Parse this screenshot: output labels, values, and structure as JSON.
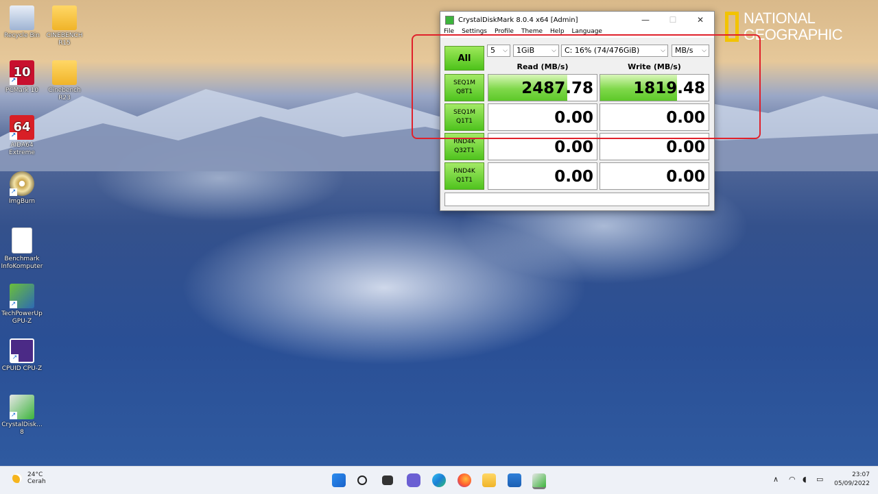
{
  "desktop": {
    "icons": [
      {
        "label": "Recycle Bin",
        "icon": "recycle-bin-icon"
      },
      {
        "label": "CINEBENCH R15",
        "icon": "folder-icon"
      },
      {
        "label": "PCMark 10",
        "icon": "pcmark-icon",
        "badge": "10"
      },
      {
        "label": "Cinebench R23",
        "icon": "folder-icon"
      },
      {
        "label": "AIDA64 Extreme",
        "icon": "aida64-icon",
        "badge": "64"
      },
      {
        "label": "ImgBurn",
        "icon": "imgburn-disc-icon"
      },
      {
        "label": "Benchmark InfoKomputer",
        "icon": "document-icon"
      },
      {
        "label": "TechPowerUp GPU-Z",
        "icon": "gpuz-icon"
      },
      {
        "label": "CPUID CPU-Z",
        "icon": "cpuz-icon"
      },
      {
        "label": "CrystalDisk... 8",
        "icon": "crystaldiskmark-icon"
      }
    ],
    "watermark": {
      "line1": "NATIONAL",
      "line2": "GEOGRAPHIC",
      "color": "#f2c300"
    }
  },
  "window": {
    "title": "CrystalDiskMark 8.0.4 x64 [Admin]",
    "controls": {
      "minimize": "—",
      "maximize": "☐",
      "close": "✕"
    },
    "menu": [
      "File",
      "Settings",
      "Profile",
      "Theme",
      "Help",
      "Language"
    ],
    "all_button": "All",
    "count_select": "5",
    "size_select": "1GiB",
    "drive_select": "C: 16% (74/476GiB)",
    "unit_select": "MB/s",
    "read_header": "Read (MB/s)",
    "write_header": "Write (MB/s)",
    "rows": [
      {
        "line1": "SEQ1M",
        "line2": "Q8T1",
        "read": "2487.78",
        "write": "1819.48",
        "read_fill": 0.73,
        "write_fill": 0.71
      },
      {
        "line1": "SEQ1M",
        "line2": "Q1T1",
        "read": "0.00",
        "write": "0.00",
        "read_fill": 0,
        "write_fill": 0
      },
      {
        "line1": "RND4K",
        "line2": "Q32T1",
        "read": "0.00",
        "write": "0.00",
        "read_fill": 0,
        "write_fill": 0
      },
      {
        "line1": "RND4K",
        "line2": "Q1T1",
        "read": "0.00",
        "write": "0.00",
        "read_fill": 0,
        "write_fill": 0
      }
    ],
    "accent": "#4dc21a"
  },
  "highlight_color": "#e0202a",
  "taskbar": {
    "weather_temp": "24°C",
    "weather_desc": "Cerah",
    "apps": [
      "start-icon",
      "search-icon",
      "task-view-icon",
      "chat-icon",
      "edge-icon",
      "firefox-icon",
      "file-explorer-icon",
      "store-icon",
      "crystaldiskmark-icon"
    ],
    "tray_chevron": "∧",
    "time": "23:07",
    "date": "05/09/2022"
  }
}
